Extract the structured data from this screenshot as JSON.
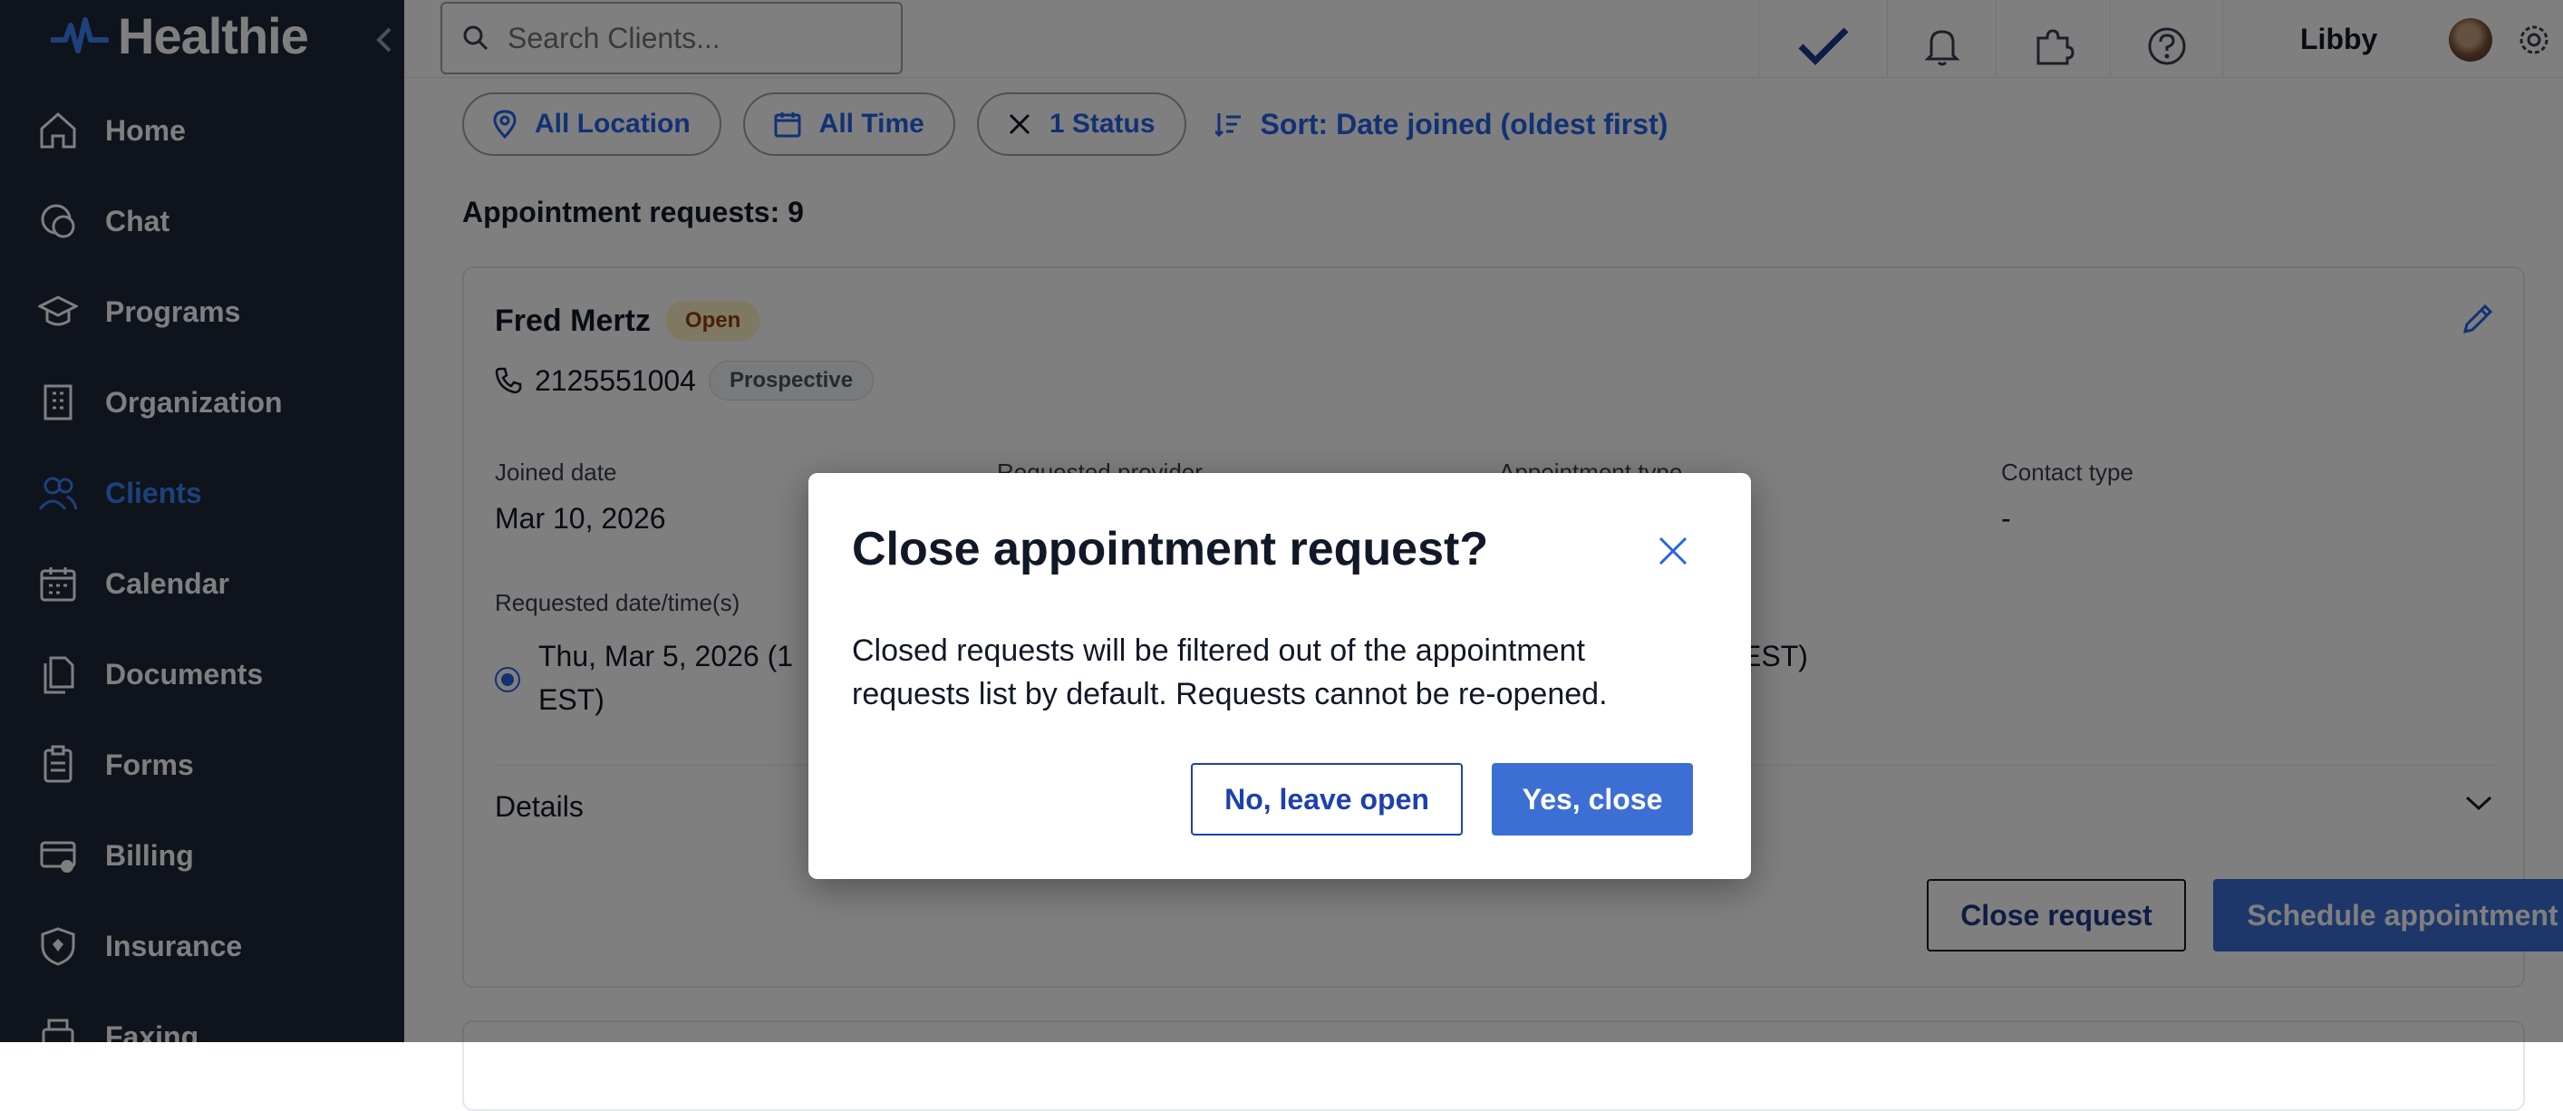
{
  "brand": {
    "name": "Healthie"
  },
  "sidebar": {
    "items": [
      {
        "label": "Home",
        "icon": "home-icon"
      },
      {
        "label": "Chat",
        "icon": "chat-icon"
      },
      {
        "label": "Programs",
        "icon": "graduation-cap-icon"
      },
      {
        "label": "Organization",
        "icon": "building-icon"
      },
      {
        "label": "Clients",
        "icon": "users-icon",
        "active": true
      },
      {
        "label": "Calendar",
        "icon": "calendar-icon"
      },
      {
        "label": "Documents",
        "icon": "documents-icon"
      },
      {
        "label": "Forms",
        "icon": "clipboard-icon"
      },
      {
        "label": "Billing",
        "icon": "billing-icon"
      },
      {
        "label": "Insurance",
        "icon": "shield-icon"
      },
      {
        "label": "Faxing",
        "icon": "fax-icon"
      }
    ]
  },
  "topbar": {
    "search_placeholder": "Search Clients...",
    "user_name": "Libby"
  },
  "filters": {
    "location": "All Location",
    "time": "All Time",
    "status": "1 Status",
    "sort": "Sort: Date joined (oldest first)"
  },
  "list": {
    "count_label": "Appointment requests: 9"
  },
  "request": {
    "client_name": "Fred Mertz",
    "status_badge": "Open",
    "phone": "2125551004",
    "client_type": "Prospective",
    "joined_label": "Joined date",
    "joined_value": "Mar 10, 2026",
    "provider_label": "Requested provider",
    "appt_type_label": "Appointment type",
    "contact_label": "Contact type",
    "contact_value": "-",
    "requested_label": "Requested date/time(s)",
    "requested_value_line1": "Thu, Mar 5, 2026 (1",
    "requested_value_line2": "EST)",
    "requested_value_tail": "EST)",
    "details_label": "Details",
    "close_button": "Close request",
    "schedule_button": "Schedule appointment"
  },
  "modal": {
    "title": "Close appointment request?",
    "body": "Closed requests will be filtered out of the appointment requests list by default. Requests cannot be re-opened.",
    "cancel": "No, leave open",
    "confirm": "Yes, close"
  },
  "colors": {
    "accent": "#3b6fd4",
    "sidebar": "#1e2638",
    "link": "#2563eb"
  }
}
